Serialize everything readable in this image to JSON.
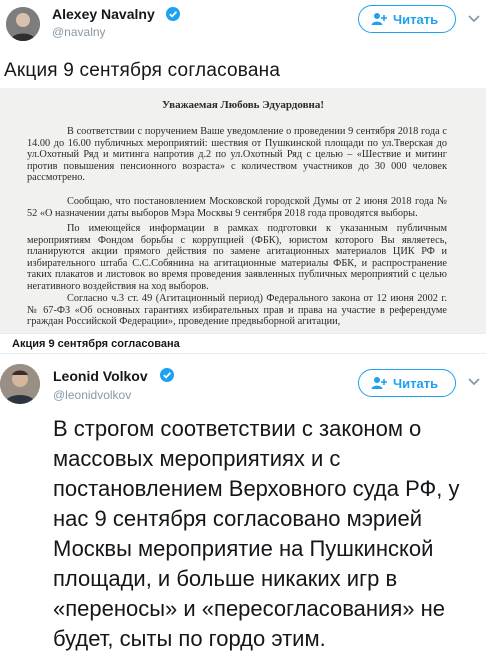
{
  "tweet1": {
    "author_name": "Alexey Navalny",
    "handle": "@navalny",
    "follow_label": "Читать",
    "text": "Акция 9 сентября согласована"
  },
  "document": {
    "salutation": "Уважаемая Любовь Эдуардовна!",
    "paragraphs": [
      "В соответствии с поручением Ваше уведомление о проведении 9 сентября 2018 года с 14.00 до 16.00 публичных мероприятий: шествия от Пушкинской площади по ул.Тверская до ул.Охотный Ряд и митинга напротив д.2 по ул.Охотный Ряд с целью – «Шествие и митинг против повышения пенсионного возраста» с количеством участников до 30 000 человек рассмотрено.",
      "Сообщаю, что постановлением Московской городской Думы от 2 июня 2018 года № 52 «О назначении даты выборов Мэра Москвы 9 сентября 2018 года проводятся выборы.",
      "По имеющейся информации в рамках подготовки к указанным публичным мероприятиям Фондом борьбы с коррупцией (ФБК), юристом которого Вы являетесь, планируются акции прямого действия по замене агитационных материалов ЦИК РФ и избирательного штаба С.С.Собянина на агитационные материалы ФБК, и распространение таких плакатов и листовок во время проведения заявленных публичных мероприятий с целью негативного воздействия на ход выборов.",
      "Согласно ч.3 ст. 49 (Агитационный период) Федерального закона от 12 июня 2002 г. № 67-ФЗ «Об основных гарантиях избирательных прав и права на участие в референдуме граждан Российской Федерации», проведение предвыборной агитации,"
    ],
    "caption": "Акция 9 сентября согласована"
  },
  "tweet2": {
    "author_name": "Leonid Volkov",
    "handle": "@leonidvolkov",
    "follow_label": "Читать",
    "text": "В строгом соответствии с законом о массовых мероприятиях и с постановлением Верховного суда РФ, у нас 9 сентября согласовано мэрией Москвы мероприятие на Пушкинской площади, и больше никаких игр в «переносы» и «пересогласования» не будет, сыты по гордо этим."
  },
  "icons": {
    "verified": "verified-badge-icon",
    "follow": "add-user-icon",
    "menu": "chevron-down-icon"
  },
  "colors": {
    "accent": "#1da1f2",
    "text": "#14171a",
    "secondary_text": "#8899a6",
    "document_background": "#f1f1ef"
  }
}
